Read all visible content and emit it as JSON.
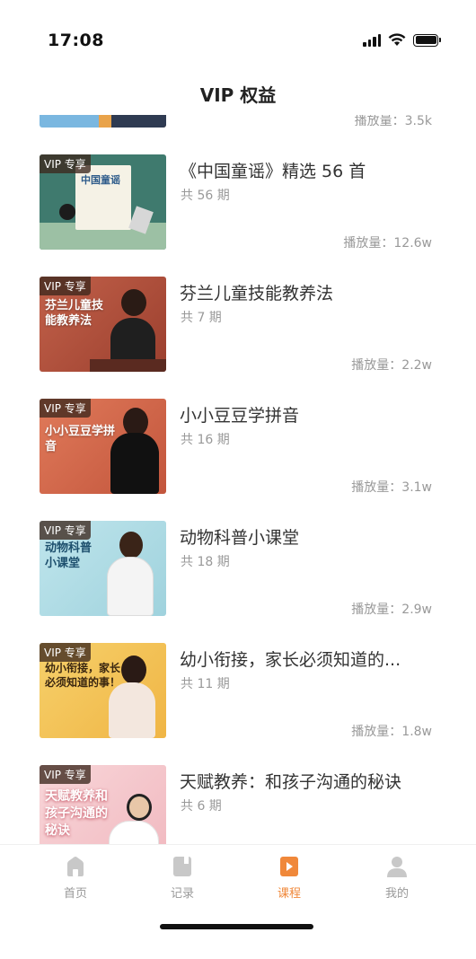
{
  "status_bar": {
    "time": "17:08"
  },
  "header": {
    "title": "VIP 权益"
  },
  "partial_top": {
    "plays": "播放量：3.5k"
  },
  "courses": [
    {
      "badge": "VIP 专享",
      "title": "《中国童谣》精选 56 首",
      "count": "共 56 期",
      "plays": "播放量：12.6w",
      "thumb_text": "中国童谣",
      "thumb_color": "#3f7a6e"
    },
    {
      "badge": "VIP 专享",
      "title": "芬兰儿童技能教养法",
      "count": "共 7 期",
      "plays": "播放量：2.2w",
      "thumb_text": "芬兰儿童技能教养法",
      "thumb_color": "#b4543e"
    },
    {
      "badge": "VIP 专享",
      "title": "小小豆豆学拼音",
      "count": "共 16 期",
      "plays": "播放量：3.1w",
      "thumb_text": "小小豆豆学拼音",
      "thumb_color": "#d96f52"
    },
    {
      "badge": "VIP 专享",
      "title": "动物科普小课堂",
      "count": "共 18 期",
      "plays": "播放量：2.9w",
      "thumb_text": "动物科普小课堂",
      "thumb_color": "#a9d9e3"
    },
    {
      "badge": "VIP 专享",
      "title": "幼小衔接，家长必须知道的...",
      "count": "共 11 期",
      "plays": "播放量：1.8w",
      "thumb_text": "幼小衔接，家长必须知道的事！",
      "thumb_color": "#f2c25a"
    },
    {
      "badge": "VIP 专享",
      "title": "天赋教养：和孩子沟通的秘诀",
      "count": "共 6 期",
      "plays": "",
      "thumb_text": "天赋教养和孩子沟通的秘诀",
      "thumb_color": "#f3c3c8"
    }
  ],
  "tab_bar": {
    "tabs": [
      {
        "label": "首页",
        "icon": "home-icon"
      },
      {
        "label": "记录",
        "icon": "record-icon"
      },
      {
        "label": "课程",
        "icon": "course-icon"
      },
      {
        "label": "我的",
        "icon": "profile-icon"
      }
    ],
    "active_index": 2,
    "active_color": "#f0883a",
    "inactive_color": "#c8c8c8"
  }
}
